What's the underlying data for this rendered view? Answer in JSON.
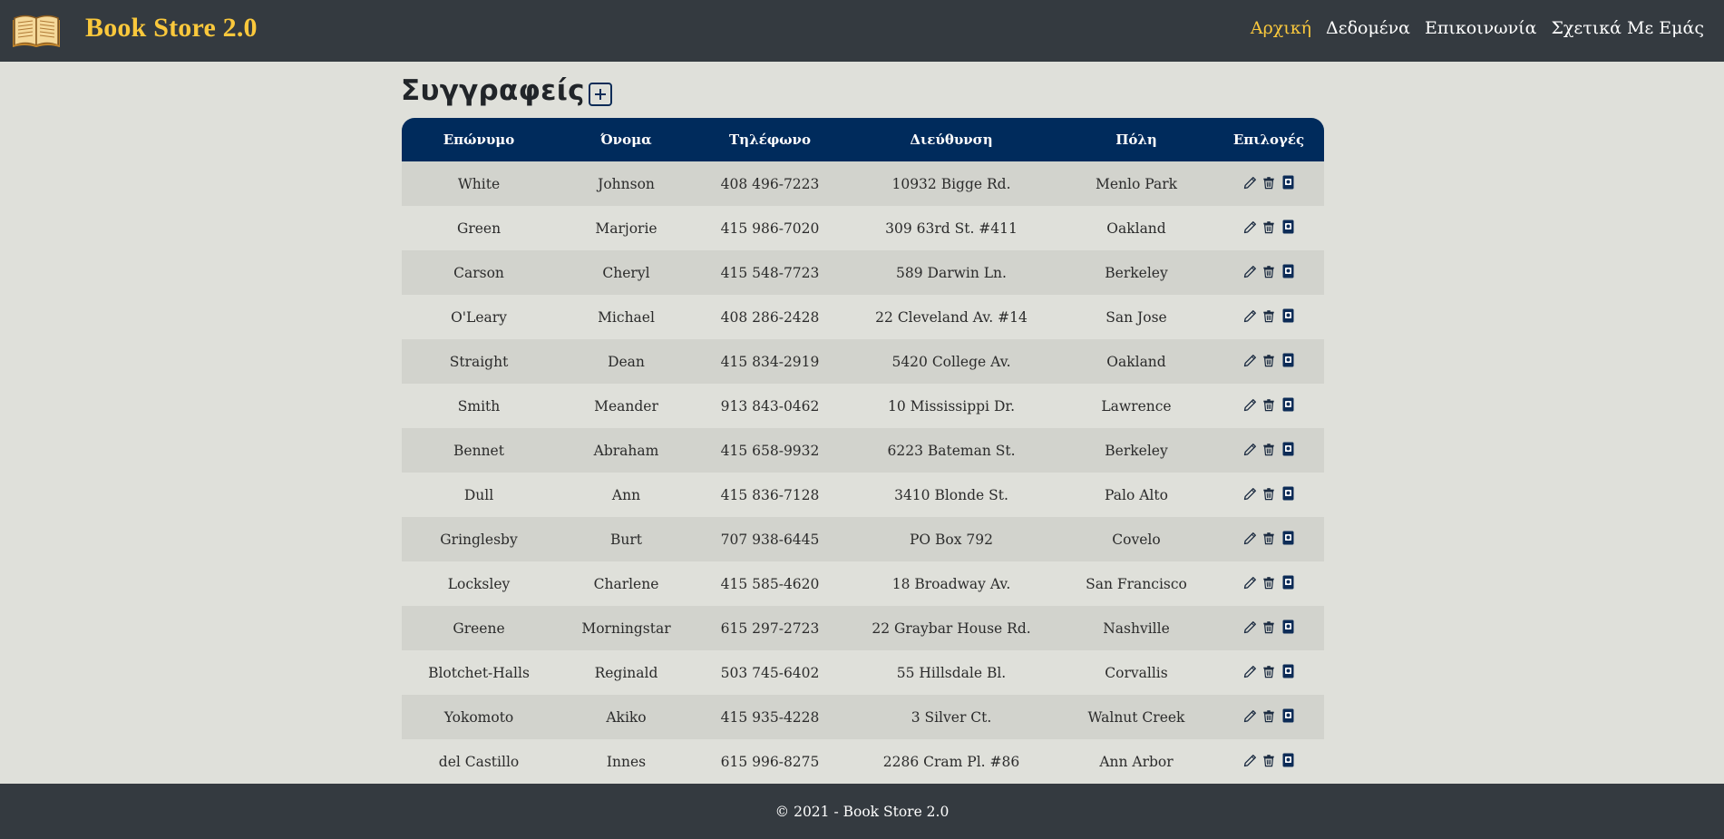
{
  "brand": {
    "title": "Book Store 2.0",
    "logo_icon": "open-book-icon"
  },
  "nav": [
    {
      "label": "Αρχική",
      "active": true
    },
    {
      "label": "Δεδομένα",
      "active": false
    },
    {
      "label": "Επικοινωνία",
      "active": false
    },
    {
      "label": "Σχετικά Με Εμάς",
      "active": false
    }
  ],
  "page": {
    "title": "Συγγραφείς",
    "add_icon": "plus-square-icon"
  },
  "table": {
    "headers": [
      "Επώνυμο",
      "Όνομα",
      "Τηλέφωνο",
      "Διεύθυνση",
      "Πόλη",
      "Επιλογές"
    ],
    "rows": [
      [
        "White",
        "Johnson",
        "408 496-7223",
        "10932 Bigge Rd.",
        "Menlo Park"
      ],
      [
        "Green",
        "Marjorie",
        "415 986-7020",
        "309 63rd St. #411",
        "Oakland"
      ],
      [
        "Carson",
        "Cheryl",
        "415 548-7723",
        "589 Darwin Ln.",
        "Berkeley"
      ],
      [
        "O'Leary",
        "Michael",
        "408 286-2428",
        "22 Cleveland Av. #14",
        "San Jose"
      ],
      [
        "Straight",
        "Dean",
        "415 834-2919",
        "5420 College Av.",
        "Oakland"
      ],
      [
        "Smith",
        "Meander",
        "913 843-0462",
        "10 Mississippi Dr.",
        "Lawrence"
      ],
      [
        "Bennet",
        "Abraham",
        "415 658-9932",
        "6223 Bateman St.",
        "Berkeley"
      ],
      [
        "Dull",
        "Ann",
        "415 836-7128",
        "3410 Blonde St.",
        "Palo Alto"
      ],
      [
        "Gringlesby",
        "Burt",
        "707 938-6445",
        "PO Box 792",
        "Covelo"
      ],
      [
        "Locksley",
        "Charlene",
        "415 585-4620",
        "18 Broadway Av.",
        "San Francisco"
      ],
      [
        "Greene",
        "Morningstar",
        "615 297-2723",
        "22 Graybar House Rd.",
        "Nashville"
      ],
      [
        "Blotchet-Halls",
        "Reginald",
        "503 745-6402",
        "55 Hillsdale Bl.",
        "Corvallis"
      ],
      [
        "Yokomoto",
        "Akiko",
        "415 935-4228",
        "3 Silver Ct.",
        "Walnut Creek"
      ],
      [
        "del Castillo",
        "Innes",
        "615 996-8275",
        "2286 Cram Pl. #86",
        "Ann Arbor"
      ]
    ],
    "action_icons": [
      "pencil-icon",
      "trash-icon",
      "book-icon"
    ]
  },
  "footer": {
    "text": "© 2021 - Book Store 2.0"
  },
  "colors": {
    "navbar": "#343a40",
    "accent": "#fac83c",
    "table_header": "#002b5c",
    "background": "#dfe0da",
    "row_stripe": "#d2d3cd"
  }
}
